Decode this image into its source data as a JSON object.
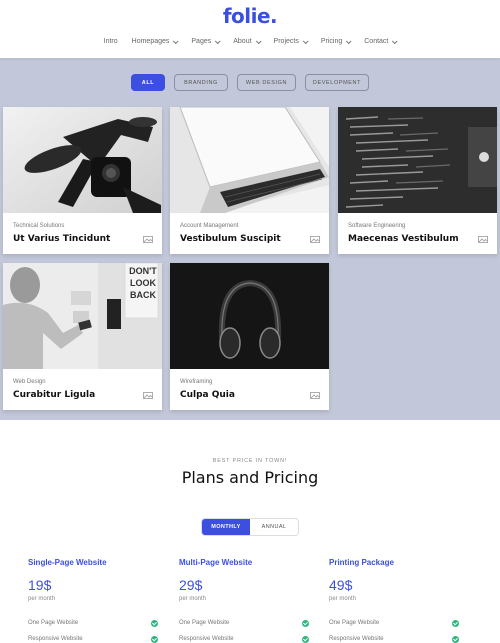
{
  "brand": {
    "logo": "folie."
  },
  "nav": {
    "items": [
      {
        "label": "Intro"
      },
      {
        "label": "Homepages"
      },
      {
        "label": "Pages"
      },
      {
        "label": "About"
      },
      {
        "label": "Projects"
      },
      {
        "label": "Pricing"
      },
      {
        "label": "Contact"
      }
    ]
  },
  "filters": [
    "ALL",
    "BRANDING",
    "WEB DESIGN",
    "DEVELOPMENT"
  ],
  "portfolio": [
    {
      "category": "Technical Solutions",
      "title": "Ut Varius Tincidunt"
    },
    {
      "category": "Account Management",
      "title": "Vestibulum Suscipit"
    },
    {
      "category": "Software Engineering",
      "title": "Maecenas Vestibulum"
    },
    {
      "category": "Web Design",
      "title": "Curabitur Ligula",
      "poster": [
        "DON'T",
        "LOOK",
        "BACK"
      ]
    },
    {
      "category": "Wireframing",
      "title": "Culpa Quia"
    }
  ],
  "pricing": {
    "eyebrow": "BEST PRICE IN TOWN!",
    "title": "Plans and Pricing",
    "toggle": {
      "monthly": "MONTHLY",
      "annual": "ANNUAL"
    },
    "plans": [
      {
        "name": "Single-Page Website",
        "price": "19$",
        "period": "per month",
        "features": [
          "One Page Website",
          "Responsive Website"
        ]
      },
      {
        "name": "Multi-Page Website",
        "price": "29$",
        "period": "per month",
        "features": [
          "One Page Website",
          "Responsive Website"
        ]
      },
      {
        "name": "Printing Package",
        "price": "49$",
        "period": "per month",
        "features": [
          "One Page Website",
          "Responsive Website"
        ]
      }
    ]
  },
  "colors": {
    "accent": "#3d4fe0",
    "section_bg": "#c2c7d9",
    "check": "#2cb67d"
  }
}
